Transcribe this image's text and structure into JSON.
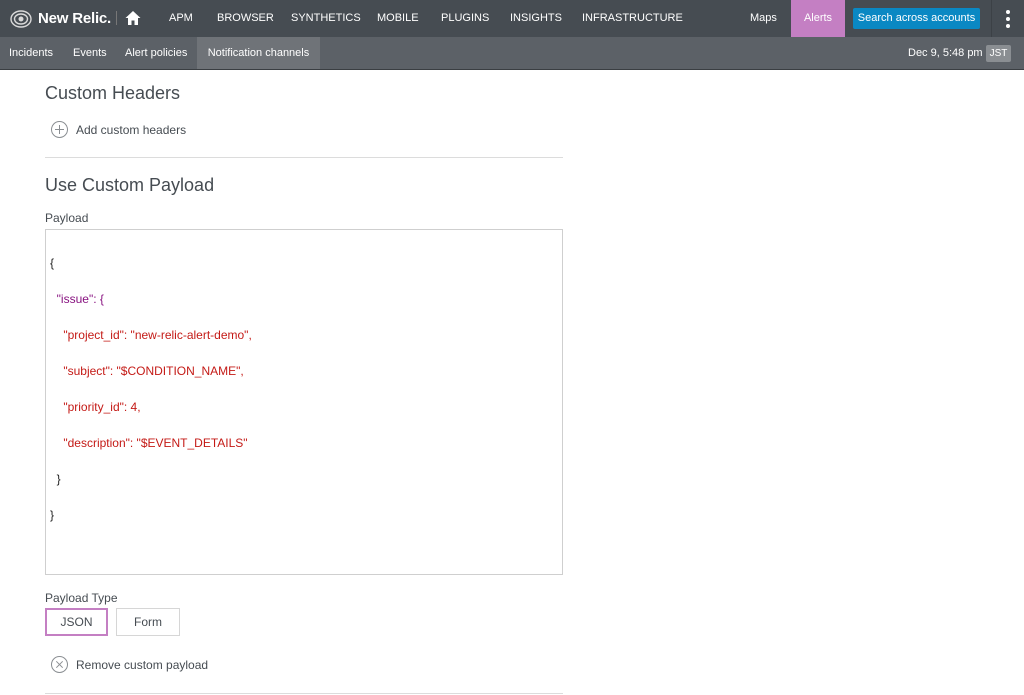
{
  "topnav": {
    "brand": "New Relic.",
    "items": [
      "APM",
      "BROWSER",
      "SYNTHETICS",
      "MOBILE",
      "PLUGINS",
      "INSIGHTS",
      "INFRASTRUCTURE"
    ],
    "maps": "Maps",
    "alerts": "Alerts",
    "search": "Search across accounts",
    "accent": "#c47fc3",
    "search_color": "#0a88c3"
  },
  "subnav": {
    "items": [
      "Incidents",
      "Events",
      "Alert policies"
    ],
    "active": "Notification channels",
    "datetime": "Dec 9, 5:48 pm",
    "timezone": "JST"
  },
  "custom_headers": {
    "title": "Custom Headers",
    "add_label": "Add custom headers"
  },
  "custom_payload": {
    "title": "Use Custom Payload",
    "payload_label": "Payload",
    "payload_lines": [
      "{",
      "  \"issue\": {",
      "    \"project_id\": \"new-relic-alert-demo\",",
      "    \"subject\": \"$CONDITION_NAME\",",
      "    \"priority_id\": 4,",
      "    \"description\": \"$EVENT_DETAILS\"",
      "  }",
      "}"
    ],
    "type_label": "Payload Type",
    "type_options": [
      "JSON",
      "Form"
    ],
    "type_selected": "JSON",
    "remove_label": "Remove custom payload"
  }
}
